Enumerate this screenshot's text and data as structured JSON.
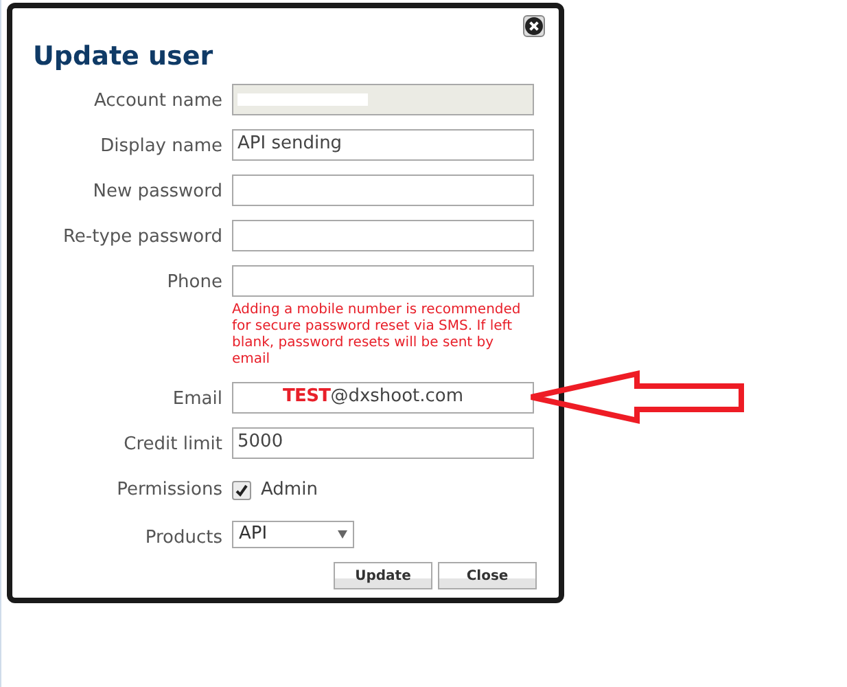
{
  "dialog": {
    "title": "Update user",
    "fields": [
      {
        "kind": "input",
        "label": "Account name",
        "disabled": true,
        "redacted": true
      },
      {
        "kind": "input",
        "label": "Display name",
        "value": "API sending",
        "disabled": false
      },
      {
        "kind": "input",
        "label": "New password",
        "disabled": false
      },
      {
        "kind": "input",
        "label": "Re-type password",
        "disabled": false
      },
      {
        "kind": "input",
        "label": "Phone",
        "disabled": false,
        "hint": "Adding a mobile number is recommended for secure password reset via SMS. If left blank, password resets will be sent by email"
      },
      {
        "kind": "input",
        "label": "Email",
        "value": "@dxshoot.com",
        "overlay": "TEST",
        "disabled": false,
        "arrow": true
      },
      {
        "kind": "input",
        "label": "Credit limit",
        "value": "5000",
        "disabled": false
      },
      {
        "kind": "checkbox",
        "label": "Permissions",
        "option": "Admin",
        "checked": true
      },
      {
        "kind": "select",
        "label": "Products",
        "value": "API"
      }
    ],
    "buttons": [
      "Update",
      "Close"
    ]
  }
}
